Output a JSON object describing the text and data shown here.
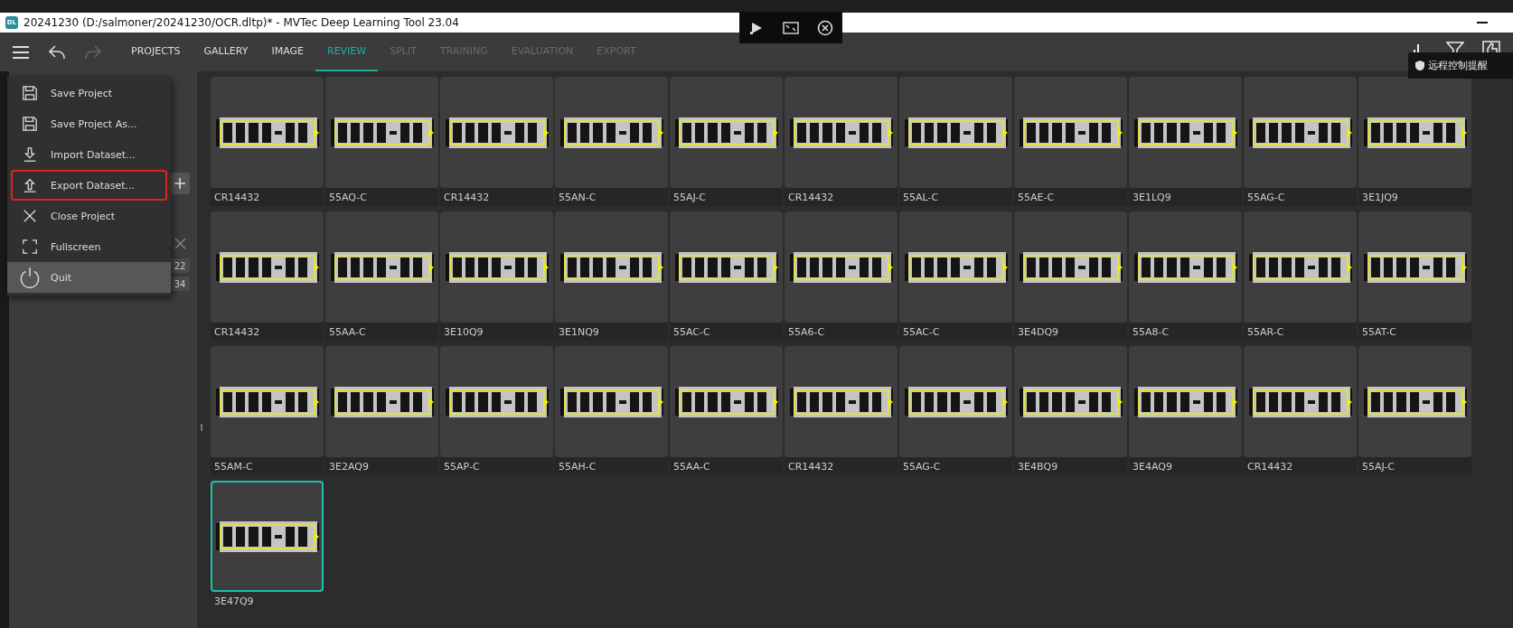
{
  "window": {
    "logo": "DL",
    "title": "20241230 (D:/salmoner/20241230/OCR.dltp)* - MVTec Deep Learning Tool 23.04"
  },
  "tabs": [
    {
      "label": "PROJECTS",
      "selected": false,
      "disabled": false
    },
    {
      "label": "GALLERY",
      "selected": false,
      "disabled": false
    },
    {
      "label": "IMAGE",
      "selected": false,
      "disabled": false
    },
    {
      "label": "REVIEW",
      "selected": true,
      "disabled": false
    },
    {
      "label": "SPLIT",
      "selected": false,
      "disabled": true
    },
    {
      "label": "TRAINING",
      "selected": false,
      "disabled": true
    },
    {
      "label": "EVALUATION",
      "selected": false,
      "disabled": true
    },
    {
      "label": "EXPORT",
      "selected": false,
      "disabled": true
    }
  ],
  "remote_notice": {
    "text": "远程控制提醒"
  },
  "sidebar": {
    "badges": [
      "22",
      "34"
    ]
  },
  "file_menu": {
    "items": [
      {
        "kind": "save",
        "label": "Save Project",
        "selected": false,
        "annotated": false
      },
      {
        "kind": "save",
        "label": "Save Project As...",
        "selected": false,
        "annotated": false
      },
      {
        "kind": "import",
        "label": "Import Dataset...",
        "selected": false,
        "annotated": false
      },
      {
        "kind": "export",
        "label": "Export Dataset...",
        "selected": false,
        "annotated": true
      },
      {
        "kind": "close",
        "label": "Close Project",
        "selected": false,
        "annotated": false
      },
      {
        "kind": "fullscreen",
        "label": "Fullscreen",
        "selected": false,
        "annotated": false
      },
      {
        "kind": "quit",
        "label": "Quit",
        "selected": true,
        "annotated": false
      }
    ]
  },
  "gallery": {
    "tiles": [
      {
        "label": "CR14432",
        "selected": false
      },
      {
        "label": "55AQ-C",
        "selected": false
      },
      {
        "label": "CR14432",
        "selected": false
      },
      {
        "label": "55AN-C",
        "selected": false
      },
      {
        "label": "55AJ-C",
        "selected": false
      },
      {
        "label": "CR14432",
        "selected": false
      },
      {
        "label": "55AL-C",
        "selected": false
      },
      {
        "label": "55AE-C",
        "selected": false
      },
      {
        "label": "3E1LQ9",
        "selected": false
      },
      {
        "label": "55AG-C",
        "selected": false
      },
      {
        "label": "3E1JQ9",
        "selected": false
      },
      {
        "label": "CR14432",
        "selected": false
      },
      {
        "label": "55AA-C",
        "selected": false
      },
      {
        "label": "3E10Q9",
        "selected": false
      },
      {
        "label": "3E1NQ9",
        "selected": false
      },
      {
        "label": "55AC-C",
        "selected": false
      },
      {
        "label": "55A6-C",
        "selected": false
      },
      {
        "label": "55AC-C",
        "selected": false
      },
      {
        "label": "3E4DQ9",
        "selected": false
      },
      {
        "label": "55A8-C",
        "selected": false
      },
      {
        "label": "55AR-C",
        "selected": false
      },
      {
        "label": "55AT-C",
        "selected": false
      },
      {
        "label": "55AM-C",
        "selected": false
      },
      {
        "label": "3E2AQ9",
        "selected": false
      },
      {
        "label": "55AP-C",
        "selected": false
      },
      {
        "label": "55AH-C",
        "selected": false
      },
      {
        "label": "55AA-C",
        "selected": false
      },
      {
        "label": "CR14432",
        "selected": false
      },
      {
        "label": "55AG-C",
        "selected": false
      },
      {
        "label": "3E4BQ9",
        "selected": false
      },
      {
        "label": "3E4AQ9",
        "selected": false
      },
      {
        "label": "CR14432",
        "selected": false
      },
      {
        "label": "55AJ-C",
        "selected": false
      },
      {
        "label": "3E47Q9",
        "selected": true
      }
    ]
  }
}
